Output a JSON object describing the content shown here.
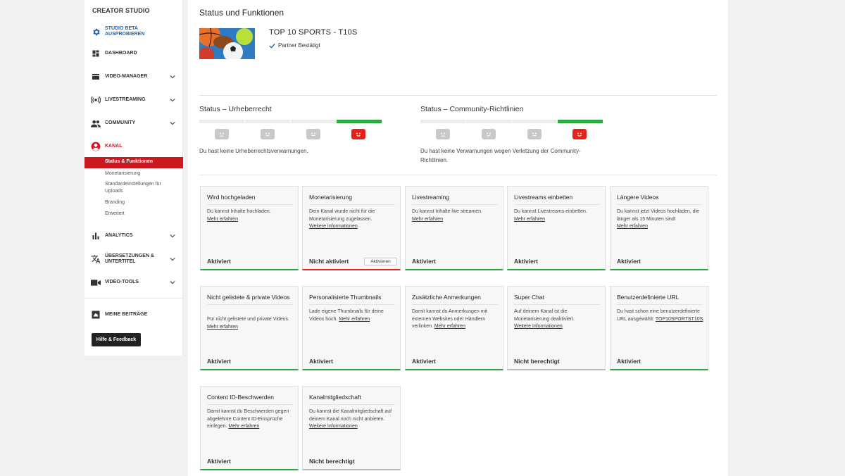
{
  "sidebar": {
    "title": "CREATOR STUDIO",
    "beta": "STUDIO BETA AUSPROBIEREN",
    "dashboard": "DASHBOARD",
    "video_manager": "VIDEO-MANAGER",
    "livestreaming": "LIVESTREAMING",
    "community": "COMMUNITY",
    "kanal": "KANAL",
    "kanal_sub": {
      "status": "Status & Funktionen",
      "monetization": "Monetarisierung",
      "upload_defaults": "Standardeinstellungen für Uploads",
      "branding": "Branding",
      "advanced": "Erweitert"
    },
    "analytics": "ANALYTICS",
    "translations": "ÜBERSETZUNGEN & UNTERTITEL",
    "video_tools": "VIDEO-TOOLS",
    "my_contributions": "MEINE BEITRÄGE",
    "help_button": "Hilfe & Feedback"
  },
  "page": {
    "title": "Status und Funktionen",
    "channel_name": "TOP 10 SPORTS - T10S",
    "partner_status": "Partner Bestätigt"
  },
  "copyright_status": {
    "title": "Status – Urheberrecht",
    "text": "Du hast keine Urheberrechtsverwarnungen."
  },
  "community_status": {
    "title": "Status – Community-Richtlinien",
    "text": "Du hast keine Verwarnungen wegen Verletzung der Community-Richtlinien."
  },
  "cards": [
    {
      "title": "Wird hochgeladen",
      "desc": "Du kannst Inhalte hochladen.",
      "link": "Mehr erfahren",
      "status": "Aktiviert"
    },
    {
      "title": "Monetarisierung",
      "desc": "Dein Kanal wurde nicht für die Monetarisierung zugelassen.",
      "link": "Weitere Informationen",
      "status": "Nicht aktiviert",
      "button": "Aktivieren"
    },
    {
      "title": "Livestreaming",
      "desc": "Du kannst Inhalte live streamen.",
      "link": "Mehr erfahren",
      "status": "Aktiviert"
    },
    {
      "title": "Livestreams einbetten",
      "desc": "Du kannst Livestreams einbetten.",
      "link": "Mehr erfahren",
      "status": "Aktiviert"
    },
    {
      "title": "Längere Videos",
      "desc": "Du kannst jetzt Videos hochladen, die länger als 15 Minuten sind!",
      "link": "Mehr erfahren",
      "status": "Aktiviert"
    },
    {
      "title": "Nicht gelistete & private Videos",
      "desc": "Für nicht gelistete und private Videos.",
      "link": "Mehr erfahren",
      "status": "Aktiviert"
    },
    {
      "title": "Personalisierte Thumbnails",
      "desc": "Lade eigene Thumbnails für deine Videos hoch.",
      "link": "Mehr erfahren",
      "status": "Aktiviert"
    },
    {
      "title": "Zusätzliche Anmerkungen",
      "desc": "Damit kannst du Anmerkungen mit externen Websites oder Händlern verlinken.",
      "link": "Mehr erfahren",
      "status": "Aktiviert"
    },
    {
      "title": "Super Chat",
      "desc": "Auf deinem Kanal ist die Monetarisierung deaktiviert.",
      "link": "Weitere Informationen",
      "status": "Nicht berechtigt"
    },
    {
      "title": "Benutzerdefinierte URL",
      "desc": "Du hast schon eine benutzerdefinierte URL ausgewählt:",
      "link": "TOP10SPORTST10S",
      "status": "Aktiviert"
    },
    {
      "title": "Content ID-Beschwerden",
      "desc": "Damit kannst du Beschwerden gegen abgelehnte Content ID-Einsprüche einlegen.",
      "link": "Mehr erfahren",
      "status": "Aktiviert"
    },
    {
      "title": "Kanalmitgliedschaft",
      "desc": "Du kannst die Kanalmitgliedschaft auf deinem Kanal noch nicht anbieten.",
      "link": "Weitere Informationen",
      "status": "Nicht berechtigt"
    }
  ],
  "colors": {
    "accent_red": "#cc181e",
    "green": "#2ba640",
    "strike_red": "#e62117"
  }
}
